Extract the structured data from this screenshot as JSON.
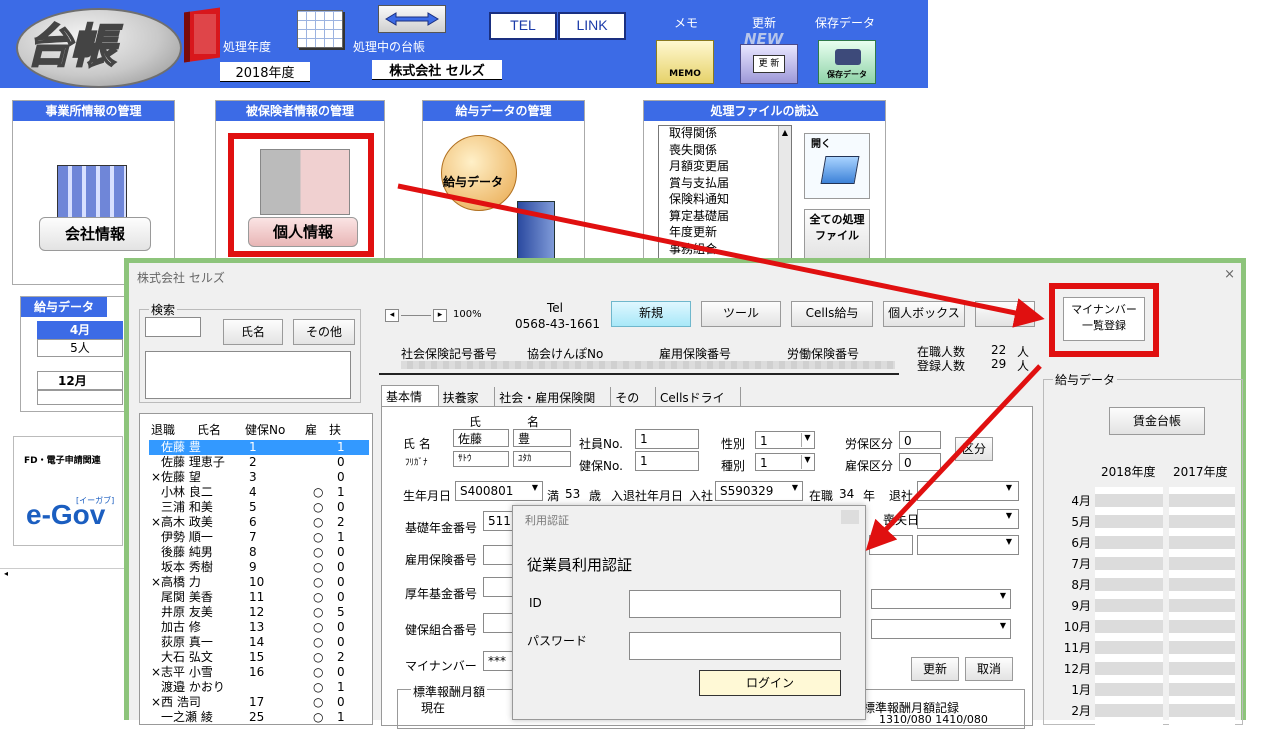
{
  "header": {
    "logo_text": "台帳",
    "fiscal_year_label": "処理年度",
    "fiscal_year_value": "2018年度",
    "ledger_label": "処理中の台帳",
    "company_name": "株式会社 セルズ",
    "tel_button": "TEL",
    "link_button": "LINK",
    "memo_label": "メモ",
    "memo_icon_text": "MEMO",
    "update_label": "更新",
    "update_icon_text": "更 新",
    "update_new_text": "NEW",
    "save_label": "保存データ",
    "save_icon_text": "保存データ"
  },
  "panels": {
    "office": {
      "title": "事業所情報の管理",
      "button": "会社情報"
    },
    "insured": {
      "title": "被保険者情報の管理",
      "button": "個人情報"
    },
    "salary": {
      "title": "給与データの管理",
      "button": "給与データ"
    },
    "files": {
      "title": "処理ファイルの読込",
      "items": [
        "取得関係",
        "喪失関係",
        "月額変更届",
        "賞与支払届",
        "保険料通知",
        "算定基礎届",
        "年度更新",
        "事務組合"
      ],
      "open_label": "開く",
      "all_button": "全ての処理ファイル"
    }
  },
  "mini_salary": {
    "title": "給与データ",
    "month1": "4月",
    "count1": "5人",
    "month2": "12月"
  },
  "egov": {
    "label": "FD・電子申請関連",
    "logo": "e-Gov",
    "logo_sub": "[イーガブ]"
  },
  "window": {
    "title": "株式会社 セルズ",
    "close": "×",
    "search": {
      "label": "検索",
      "name_button": "氏名",
      "other_button": "その他"
    },
    "list_headers": {
      "retired": "退職",
      "name": "氏名",
      "hoken_no": "健保No",
      "employ": "雇",
      "dependents": "扶"
    },
    "employees": [
      {
        "x": "",
        "name": "佐藤 豊",
        "no": "1",
        "koyo": "",
        "fu": "1"
      },
      {
        "x": "",
        "name": "佐藤 理恵子",
        "no": "2",
        "koyo": "",
        "fu": "0"
      },
      {
        "x": "×",
        "name": "佐藤 望",
        "no": "3",
        "koyo": "",
        "fu": "0"
      },
      {
        "x": "",
        "name": "小林 良二",
        "no": "4",
        "koyo": "○",
        "fu": "1"
      },
      {
        "x": "",
        "name": "三浦 和美",
        "no": "5",
        "koyo": "○",
        "fu": "0"
      },
      {
        "x": "×",
        "name": "高木 政美",
        "no": "6",
        "koyo": "○",
        "fu": "2"
      },
      {
        "x": "",
        "name": "伊勢 順一",
        "no": "7",
        "koyo": "○",
        "fu": "1"
      },
      {
        "x": "",
        "name": "後藤 純男",
        "no": "8",
        "koyo": "○",
        "fu": "0"
      },
      {
        "x": "",
        "name": "坂本 秀樹",
        "no": "9",
        "koyo": "○",
        "fu": "0"
      },
      {
        "x": "×",
        "name": "高橋 力",
        "no": "10",
        "koyo": "○",
        "fu": "0"
      },
      {
        "x": "",
        "name": "尾関 美香",
        "no": "11",
        "koyo": "○",
        "fu": "0"
      },
      {
        "x": "",
        "name": "井原 友美",
        "no": "12",
        "koyo": "○",
        "fu": "5"
      },
      {
        "x": "",
        "name": "加古 修",
        "no": "13",
        "koyo": "○",
        "fu": "0"
      },
      {
        "x": "",
        "name": "荻原 真一",
        "no": "14",
        "koyo": "○",
        "fu": "0"
      },
      {
        "x": "",
        "name": "大石 弘文",
        "no": "15",
        "koyo": "○",
        "fu": "2"
      },
      {
        "x": "×",
        "name": "志平 小雪",
        "no": "16",
        "koyo": "○",
        "fu": "0"
      },
      {
        "x": "",
        "name": "渡邉 かおり",
        "no": "",
        "koyo": "○",
        "fu": "1"
      },
      {
        "x": "×",
        "name": "西 浩司",
        "no": "17",
        "koyo": "○",
        "fu": "0"
      },
      {
        "x": "",
        "name": "一之瀬 綾",
        "no": "25",
        "koyo": "○",
        "fu": "1"
      }
    ],
    "zoom": "100%",
    "tel_label": "Tel",
    "tel_value": "0568-43-1661",
    "toolbar": {
      "new": "新規",
      "tool": "ツール",
      "cells_salary": "Cells給与",
      "personal_box": "個人ボックス",
      "mynumber_line1": "マイナンバー",
      "mynumber_line2": "一覧登録"
    },
    "codes": {
      "shaho": "社会保険記号番号",
      "kyokai": "協会けんぽNo",
      "koyo": "雇用保険番号",
      "rodo": "労働保険番号"
    },
    "counts": {
      "enrolled_label": "在職人数",
      "enrolled_value": "22",
      "registered_label": "登録人数",
      "registered_value": "29",
      "unit": "人"
    },
    "tabs": [
      "基本情報",
      "扶養家族",
      "社会・雇用保険関係",
      "その他",
      "Cellsドライブ"
    ],
    "form": {
      "shi": "氏",
      "mei": "名",
      "name_label": "氏 名",
      "last": "佐藤",
      "first": "豊",
      "kana_label": "ﾌﾘｶﾞﾅ",
      "last_kana": "ｻﾄｳ",
      "first_kana": "ﾕﾀｶ",
      "emp_no_label": "社員No.",
      "emp_no": "1",
      "hoken_no_label": "健保No.",
      "hoken_no": "1",
      "gender_label": "性別",
      "gender": "1",
      "type_label": "種別",
      "type": "1",
      "rouho_label": "労保区分",
      "rouho": "0",
      "koyo_label": "雇保区分",
      "koyo": "0",
      "kubun_button": "区分",
      "birth_label": "生年月日",
      "birth": "S400801",
      "age_prefix": "満",
      "age": "53",
      "age_unit": "歳",
      "entry_label": "入退社年月日",
      "entry_prefix": "入社",
      "entry": "S590329",
      "tenure_prefix": "在職",
      "tenure": "34",
      "tenure_unit": "年",
      "retire_label": "退社",
      "kiso_label": "基礎年金番号",
      "kiso": "511",
      "loss_label": "喪失日",
      "koyo_no_label": "雇用保険番号",
      "kosei_label": "厚年基金番号",
      "kenpo_label": "健保組合番号",
      "mynumber_label": "マイナンバー",
      "mynumber": "***",
      "update_button": "更新",
      "cancel_button": "取消",
      "std_label": "標準報酬月額",
      "current_label": "現在",
      "std_record_label": "標準報酬月額記録",
      "std_record_value": "1310/080 1410/080"
    },
    "salary_panel": {
      "title": "給与データ",
      "ledger_button": "賃金台帳",
      "years": [
        "2018年度",
        "2017年度"
      ],
      "months": [
        "4月",
        "5月",
        "6月",
        "7月",
        "8月",
        "9月",
        "10月",
        "11月",
        "12月",
        "1月",
        "2月"
      ]
    }
  },
  "dialog": {
    "title": "利用認証",
    "heading": "従業員利用認証",
    "id_label": "ID",
    "password_label": "パスワード",
    "login_button": "ログイン"
  },
  "colors": {
    "header_blue": "#3c6be6",
    "highlight": "#e01010",
    "window_border": "#8dc47b"
  }
}
